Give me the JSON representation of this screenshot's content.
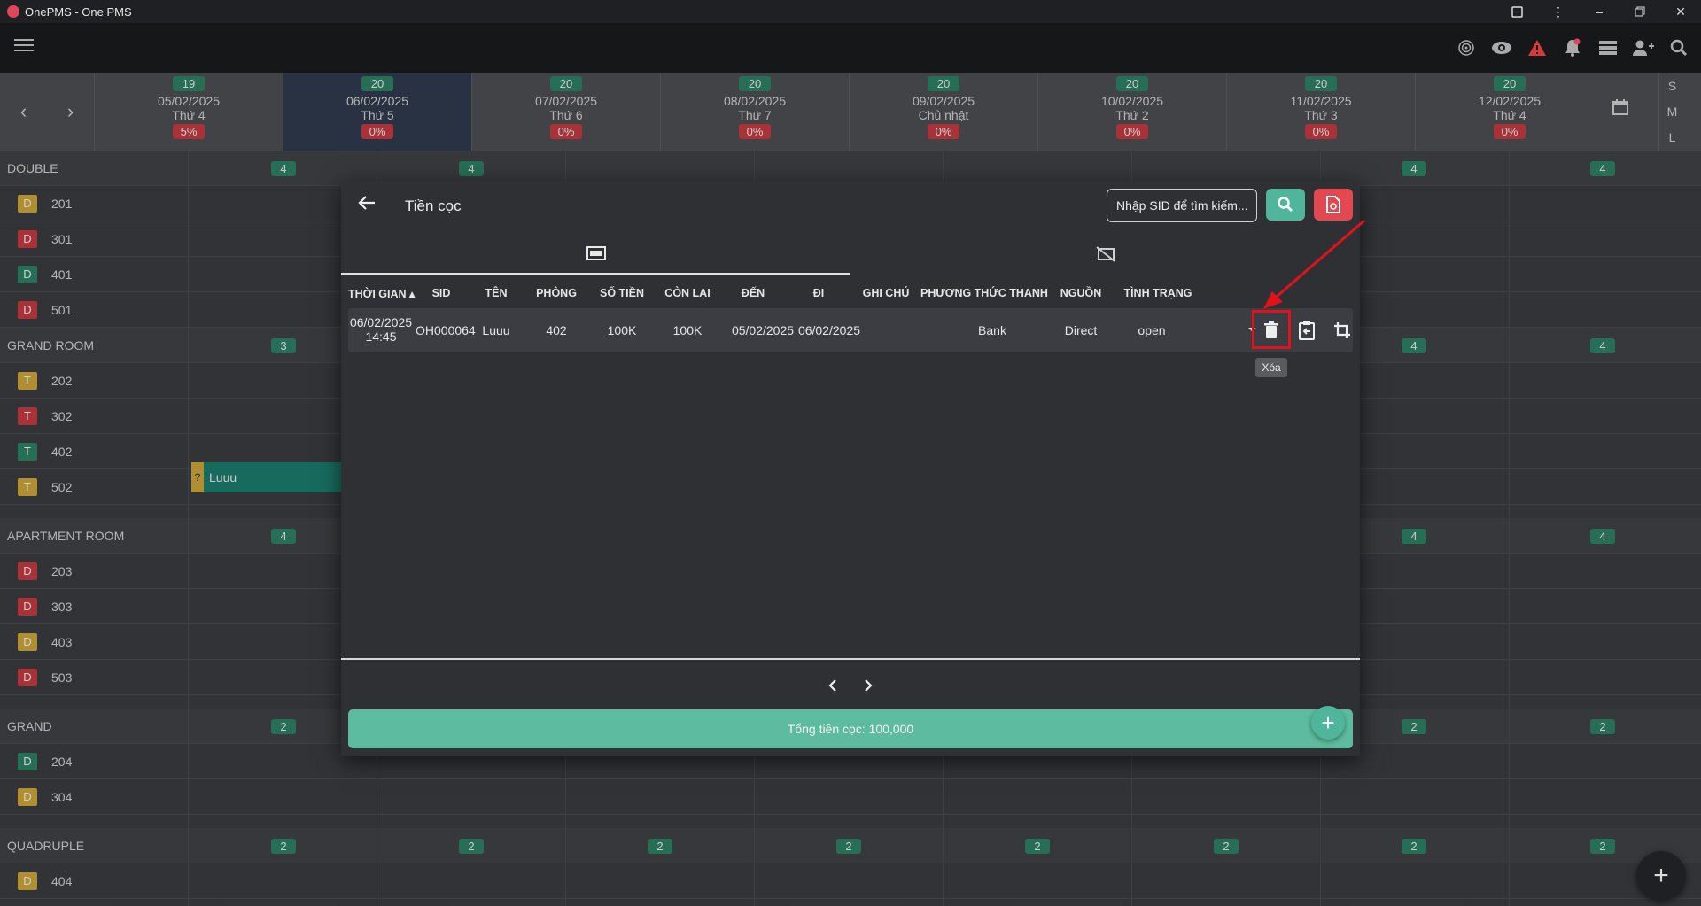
{
  "window": {
    "title": "OnePMS - One PMS"
  },
  "dates": [
    {
      "badge": "19",
      "date": "05/02/2025",
      "day": "Thứ 4",
      "pct": "5%"
    },
    {
      "badge": "20",
      "date": "06/02/2025",
      "day": "Thứ 5",
      "pct": "0%"
    },
    {
      "badge": "20",
      "date": "07/02/2025",
      "day": "Thứ 6",
      "pct": "0%"
    },
    {
      "badge": "20",
      "date": "08/02/2025",
      "day": "Thứ 7",
      "pct": "0%"
    },
    {
      "badge": "20",
      "date": "09/02/2025",
      "day": "Chủ nhật",
      "pct": "0%"
    },
    {
      "badge": "20",
      "date": "10/02/2025",
      "day": "Thứ 2",
      "pct": "0%"
    },
    {
      "badge": "20",
      "date": "11/02/2025",
      "day": "Thứ 3",
      "pct": "0%"
    },
    {
      "badge": "20",
      "date": "12/02/2025",
      "day": "Thứ 4",
      "pct": "0%"
    }
  ],
  "size_options": [
    "S",
    "M",
    "L"
  ],
  "categories": [
    {
      "name": "DOUBLE",
      "count": "4",
      "rooms": [
        {
          "tag": "D",
          "num": "201"
        },
        {
          "tag": "D",
          "num": "301"
        },
        {
          "tag": "D",
          "num": "401"
        },
        {
          "tag": "D",
          "num": "501"
        }
      ]
    },
    {
      "name": "GRAND ROOM",
      "count": "3",
      "rooms": [
        {
          "tag": "T",
          "num": "202"
        },
        {
          "tag": "T",
          "num": "302"
        },
        {
          "tag": "T",
          "num": "402"
        },
        {
          "tag": "T",
          "num": "502"
        }
      ]
    },
    {
      "name": "APARTMENT ROOM",
      "count": "4",
      "rooms": [
        {
          "tag": "D",
          "num": "203"
        },
        {
          "tag": "D",
          "num": "303"
        },
        {
          "tag": "D",
          "num": "403"
        },
        {
          "tag": "D",
          "num": "503"
        }
      ]
    },
    {
      "name": "GRAND",
      "count": "2",
      "rooms": [
        {
          "tag": "D",
          "num": "204"
        },
        {
          "tag": "D",
          "num": "304"
        }
      ]
    },
    {
      "name": "QUADRUPLE",
      "count": "2",
      "rooms": [
        {
          "tag": "D",
          "num": "404"
        }
      ]
    }
  ],
  "booking": {
    "flag": "?",
    "guest": "Luuu"
  },
  "modal": {
    "title": "Tiền cọc",
    "search_placeholder": "Nhập SID để tìm kiếm...",
    "columns": [
      "THỜI GIAN ▴",
      "SID",
      "TÊN",
      "PHÒNG",
      "SỐ TIỀN",
      "CÒN LẠI",
      "ĐẾN",
      "ĐI",
      "GHI CHÚ",
      "PHƯƠNG THỨC THANH",
      "NGUỒN",
      "TÌNH TRẠNG"
    ],
    "rows": [
      {
        "time_date": "06/02/2025",
        "time_hour": "14:45",
        "sid": "OH000064",
        "name": "Luuu",
        "room": "402",
        "amount": "100K",
        "remaining": "100K",
        "arrive": "05/02/2025",
        "depart": "06/02/2025",
        "note": "",
        "payment": "Bank",
        "source": "Direct",
        "status": "open"
      }
    ],
    "delete_tooltip": "Xóa",
    "total_label": "Tổng tiền cọc: 100,000"
  },
  "colors": {
    "accent": "#5dbc9f",
    "danger": "#e3474f",
    "highlight": "#e0131c"
  }
}
